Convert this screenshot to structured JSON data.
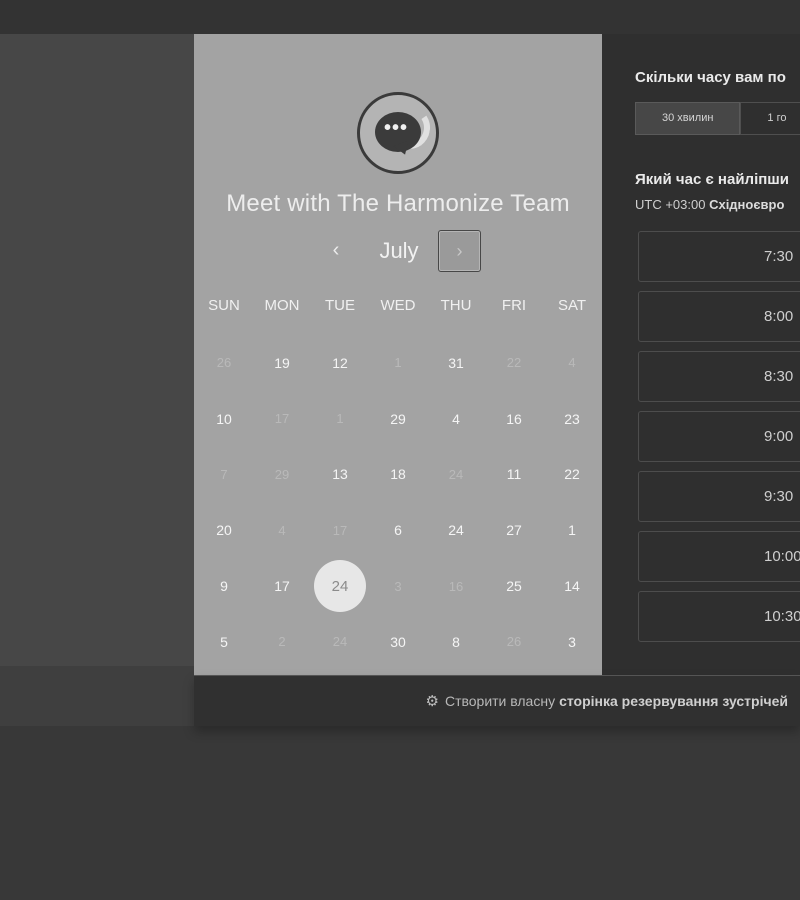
{
  "meeting": {
    "title": "Meet with The Harmonize Team",
    "month": "July",
    "prev_icon": "‹",
    "next_icon": "›"
  },
  "weekdays": [
    "SUN",
    "MON",
    "TUE",
    "WED",
    "THU",
    "FRI",
    "SAT"
  ],
  "calendar": [
    [
      {
        "d": "26",
        "dim": true
      },
      {
        "d": "19",
        "dim": false
      },
      {
        "d": "12",
        "dim": false
      },
      {
        "d": "1",
        "dim": true
      },
      {
        "d": "31",
        "dim": false
      },
      {
        "d": "22",
        "dim": true
      },
      {
        "d": "4",
        "dim": true
      }
    ],
    [
      {
        "d": "10",
        "dim": false
      },
      {
        "d": "17",
        "dim": true
      },
      {
        "d": "1",
        "dim": true
      },
      {
        "d": "29",
        "dim": false
      },
      {
        "d": "4",
        "dim": false
      },
      {
        "d": "16",
        "dim": false
      },
      {
        "d": "23",
        "dim": false
      }
    ],
    [
      {
        "d": "7",
        "dim": true
      },
      {
        "d": "29",
        "dim": true
      },
      {
        "d": "13",
        "dim": false
      },
      {
        "d": "18",
        "dim": false
      },
      {
        "d": "24",
        "dim": true
      },
      {
        "d": "11",
        "dim": false
      },
      {
        "d": "22",
        "dim": false
      }
    ],
    [
      {
        "d": "20",
        "dim": false
      },
      {
        "d": "4",
        "dim": true
      },
      {
        "d": "17",
        "dim": true
      },
      {
        "d": "6",
        "dim": false
      },
      {
        "d": "24",
        "dim": false
      },
      {
        "d": "27",
        "dim": false
      },
      {
        "d": "1",
        "dim": false
      }
    ],
    [
      {
        "d": "9",
        "dim": false
      },
      {
        "d": "17",
        "dim": false
      },
      {
        "d": "24",
        "dim": false,
        "selected": true
      },
      {
        "d": "3",
        "dim": true
      },
      {
        "d": "16",
        "dim": true
      },
      {
        "d": "25",
        "dim": false
      },
      {
        "d": "14",
        "dim": false
      }
    ],
    [
      {
        "d": "5",
        "dim": false
      },
      {
        "d": "2",
        "dim": true
      },
      {
        "d": "24",
        "dim": true
      },
      {
        "d": "30",
        "dim": false
      },
      {
        "d": "8",
        "dim": false
      },
      {
        "d": "26",
        "dim": true
      },
      {
        "d": "3",
        "dim": false
      }
    ]
  ],
  "scheduler": {
    "duration_question": "Скільки часу вам по",
    "durations": [
      "30 хвилин",
      "1 го"
    ],
    "time_question": "Який час є найліпши",
    "timezone_prefix": "UTC +03:00",
    "timezone_name": "Східноєвро",
    "slots": [
      "7:30",
      "8:00",
      "8:30",
      "9:00",
      "9:30",
      "10:00",
      "10:30"
    ]
  },
  "footer": {
    "icon": "sprocket-icon",
    "prefix": "Створити власну",
    "link": "сторінка резервування зустрічей"
  }
}
